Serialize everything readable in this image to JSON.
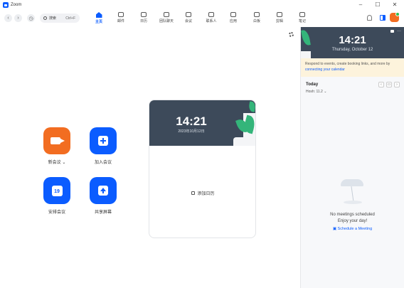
{
  "window": {
    "title": "Zoom",
    "controls": [
      "–",
      "☐",
      "✕"
    ]
  },
  "toolbar": {
    "search_label": "搜索",
    "search_shortcut": "Ctrl+F",
    "tabs": [
      {
        "label": "主页",
        "icon": "home-icon",
        "active": true
      },
      {
        "label": "邮件",
        "icon": "mail-icon"
      },
      {
        "label": "日历",
        "icon": "calendar-icon"
      },
      {
        "label": "团队聊天",
        "icon": "chat-icon"
      },
      {
        "label": "会议",
        "icon": "video-icon"
      },
      {
        "label": "联系人",
        "icon": "contacts-icon"
      },
      {
        "label": "应用",
        "icon": "apps-icon"
      },
      {
        "label": "白板",
        "icon": "whiteboard-icon"
      },
      {
        "label": "剪辑",
        "icon": "clips-icon"
      },
      {
        "label": "笔记",
        "icon": "notes-icon"
      }
    ]
  },
  "actions": {
    "new_meeting": "新会议",
    "join": "加入会议",
    "schedule": "安排会议",
    "share": "共享屏幕",
    "calendar_day": "19"
  },
  "calendar_card": {
    "time": "14:21",
    "date": "2023年10月12日",
    "add_calendar": "添加日历"
  },
  "right_panel": {
    "time": "14:21",
    "date": "Thursday, October 12",
    "notice_text": "Respond to events, create booking links, and more by ",
    "notice_link": "connecting your calendar",
    "today_label": "Today",
    "timezone": "Hosh: 11.2",
    "empty_title": "No meetings scheduled",
    "empty_sub": "Enjoy your day!",
    "schedule_link": "Schedule a Meeting"
  },
  "colors": {
    "accent": "#0b5cff",
    "new_meeting": "#f26d21",
    "banner": "#3d4a5a"
  }
}
